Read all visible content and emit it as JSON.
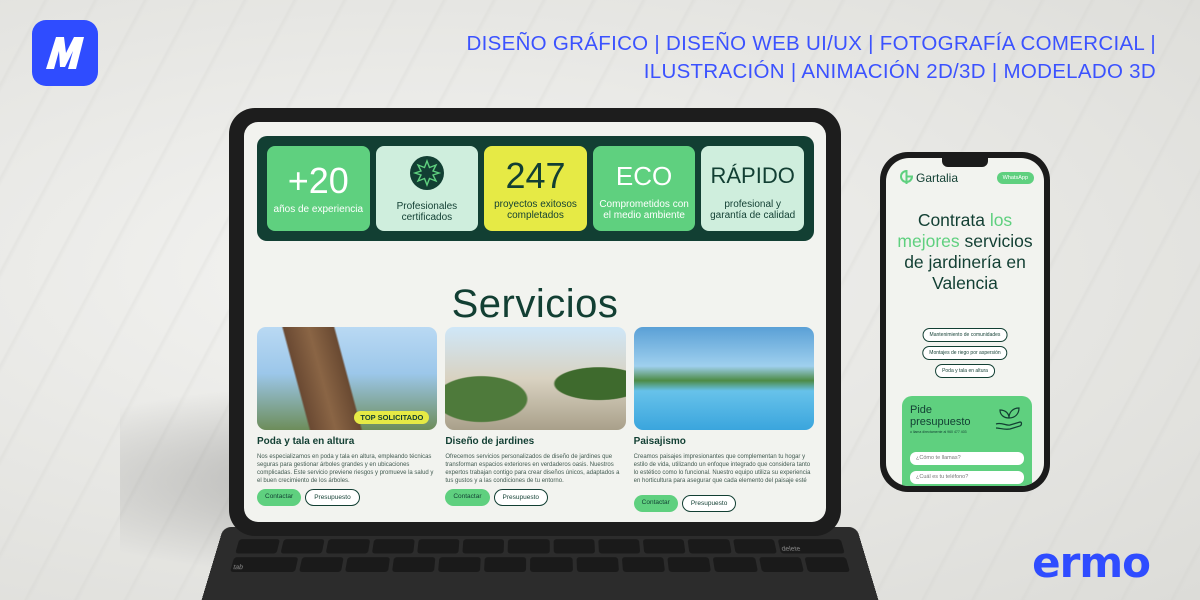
{
  "brand": {
    "logo_letter": "M",
    "tagline_line1": "DISEÑO GRÁFICO | DISEÑO WEB UI/UX | FOTOGRAFÍA COMERCIAL |",
    "tagline_line2": "ILUSTRACIÓN | ANIMACIÓN 2D/3D | MODELADO 3D",
    "footer_logo": "ermo",
    "accent_color": "#2f4cff"
  },
  "tablet": {
    "stats": [
      {
        "value": "+20",
        "label": "años de experiencia"
      },
      {
        "icon": "certified-badge-icon",
        "label": "Profesionales certificados"
      },
      {
        "value": "247",
        "label": "proyectos exitosos completados"
      },
      {
        "value": "ECO",
        "label": "Comprometidos con el medio ambiente"
      },
      {
        "value": "RÁPIDO",
        "label": "profesional y garantía de calidad"
      }
    ],
    "section_title": "Servicios",
    "services": [
      {
        "title": "Poda y tala en altura",
        "badge": "TOP SOLICITADO",
        "desc": "Nos especializamos en poda y tala en altura, empleando técnicas seguras para gestionar árboles grandes y en ubicaciones complicadas. Este servicio previene riesgos y promueve la salud y el buen crecimiento de los árboles.",
        "btn_contact": "Contactar",
        "btn_quote": "Presupuesto"
      },
      {
        "title": "Diseño de jardines",
        "desc": "Ofrecemos servicios personalizados de diseño de jardines que transforman espacios exteriores en verdaderos oasis. Nuestros expertos trabajan contigo para crear diseños únicos, adaptados a tus gustos y a las condiciones de tu entorno.",
        "btn_contact": "Contactar",
        "btn_quote": "Presupuesto"
      },
      {
        "title": "Paisajismo",
        "desc": "Creamos paisajes impresionantes que complementan tu hogar y estilo de vida, utilizando un enfoque integrado que considera tanto lo estético como lo funcional. Nuestro equipo utiliza su experiencia en horticultura para asegurar que cada elemento del paisaje esté en perfecta armonía.",
        "btn_contact": "Contactar",
        "btn_quote": "Presupuesto"
      }
    ],
    "keyboard": {
      "left_key": "tab",
      "right_key": "delete"
    }
  },
  "phone": {
    "logo": "Gartalia",
    "whatsapp": "WhatsApp",
    "headline_a": "Contrata",
    "headline_hl": "los mejores",
    "headline_b": "servicios de jardinería en Valencia",
    "pills": [
      "Mantenimiento de comunidades",
      "Montajes de riego por aspersión",
      "Poda y tala en altura"
    ],
    "form_title": "Pide presupuesto",
    "form_sub": "o llama directamente al 960 477 403",
    "field1": "¿Cómo te llamas?",
    "field2": "¿Cuál es tu teléfono?"
  }
}
